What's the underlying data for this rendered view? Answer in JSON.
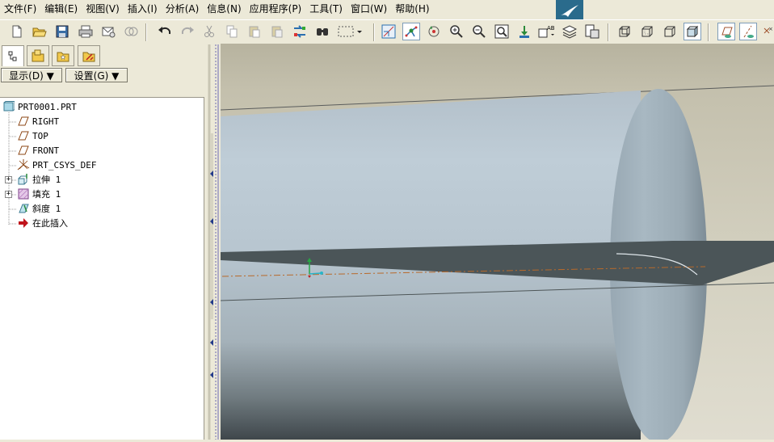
{
  "menu": [
    "文件(F)",
    "编辑(E)",
    "视图(V)",
    "插入(I)",
    "分析(A)",
    "信息(N)",
    "应用程序(P)",
    "工具(T)",
    "窗口(W)",
    "帮助(H)"
  ],
  "panel": {
    "show_button": "显示(D) ▼",
    "settings_button": "设置(G) ▼"
  },
  "tree": {
    "root": "PRT0001.PRT",
    "items": [
      "RIGHT",
      "TOP",
      "FRONT",
      "PRT_CSYS_DEF",
      "拉伸 1",
      "填充 1",
      "斜度 1",
      "在此插入"
    ]
  },
  "colors": {
    "viewport_bg": "#d1cebc",
    "cylinder": "#b5c3cd",
    "fill_plane": "#4b5558",
    "accent": "#2a6b8c"
  }
}
